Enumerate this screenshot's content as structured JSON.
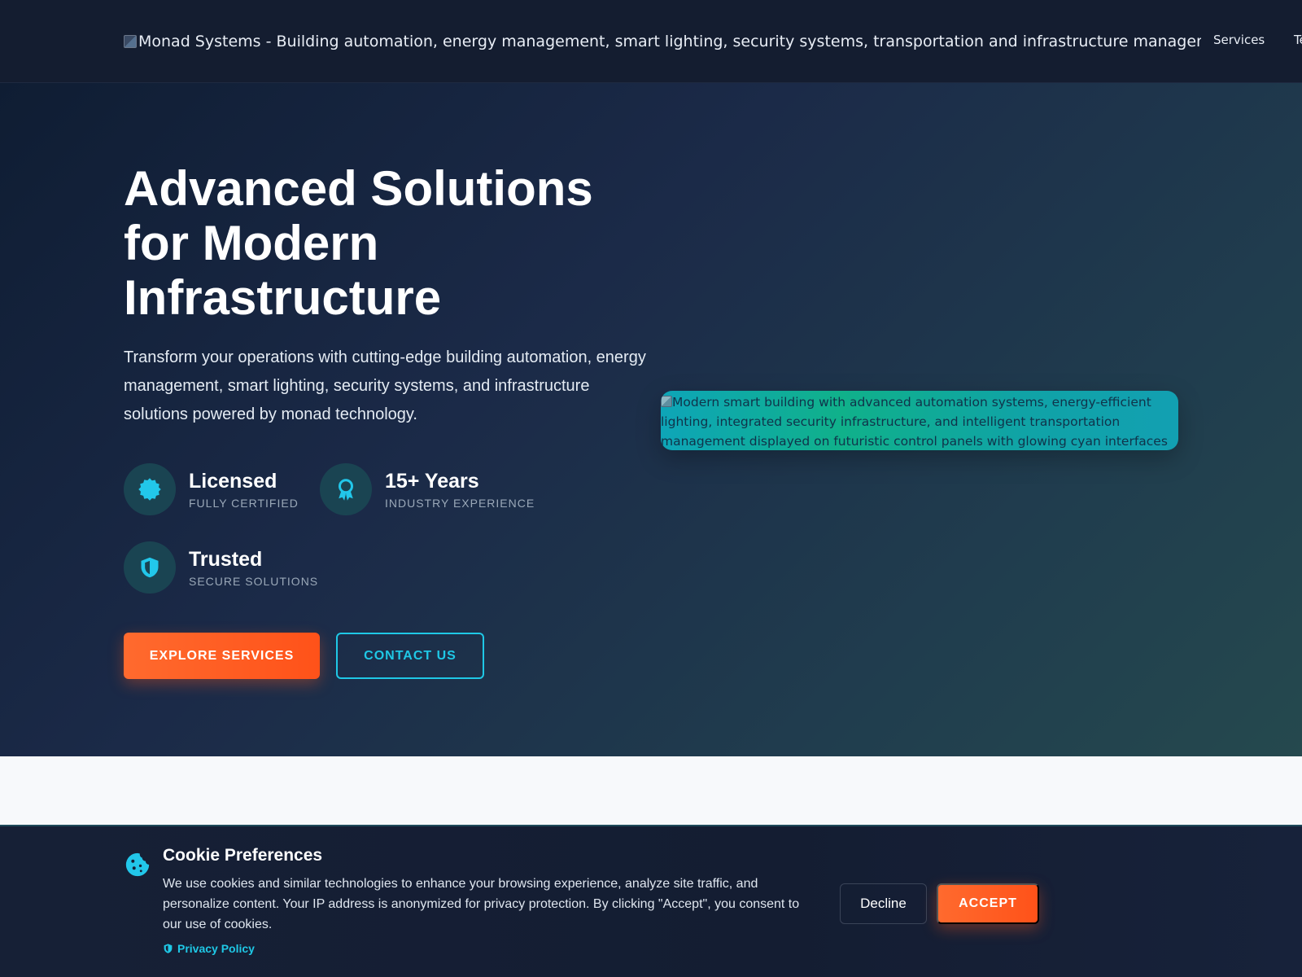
{
  "header": {
    "logo_alt": "Monad Systems - Building automation, energy management, smart lighting, security systems, transportation and infrastructure management logo",
    "nav": [
      {
        "label": "Services"
      },
      {
        "label": "Te"
      }
    ]
  },
  "hero": {
    "title": "Advanced Solutions for Modern Infrastructure",
    "subtitle": "Transform your operations with cutting-edge building automation, energy management, smart lighting, security systems, and infrastructure solutions powered by monad technology.",
    "badges": [
      {
        "title": "Licensed",
        "subtitle": "FULLY CERTIFIED",
        "icon": "badge-check-icon"
      },
      {
        "title": "15+ Years",
        "subtitle": "INDUSTRY EXPERIENCE",
        "icon": "award-icon"
      },
      {
        "title": "Trusted",
        "subtitle": "SECURE SOLUTIONS",
        "icon": "shield-icon"
      }
    ],
    "explore_label": "EXPLORE SERVICES",
    "contact_label": "CONTACT US",
    "image_alt": "Modern smart building with advanced automation systems, energy-efficient lighting, integrated security infrastructure, and intelligent transportation management displayed on futuristic control panels with glowing cyan interfaces"
  },
  "cookie": {
    "title": "Cookie Preferences",
    "text": "We use cookies and similar technologies to enhance your browsing experience, analyze site traffic, and personalize content. Your IP address is anonymized for privacy protection. By clicking \"Accept\", you consent to our use of cookies.",
    "privacy_label": "Privacy Policy",
    "decline_label": "Decline",
    "accept_label": "ACCEPT"
  },
  "colors": {
    "accent_cyan": "#1fc8e6",
    "accent_orange": "#ff5a1f",
    "header_bg": "#141d30"
  }
}
